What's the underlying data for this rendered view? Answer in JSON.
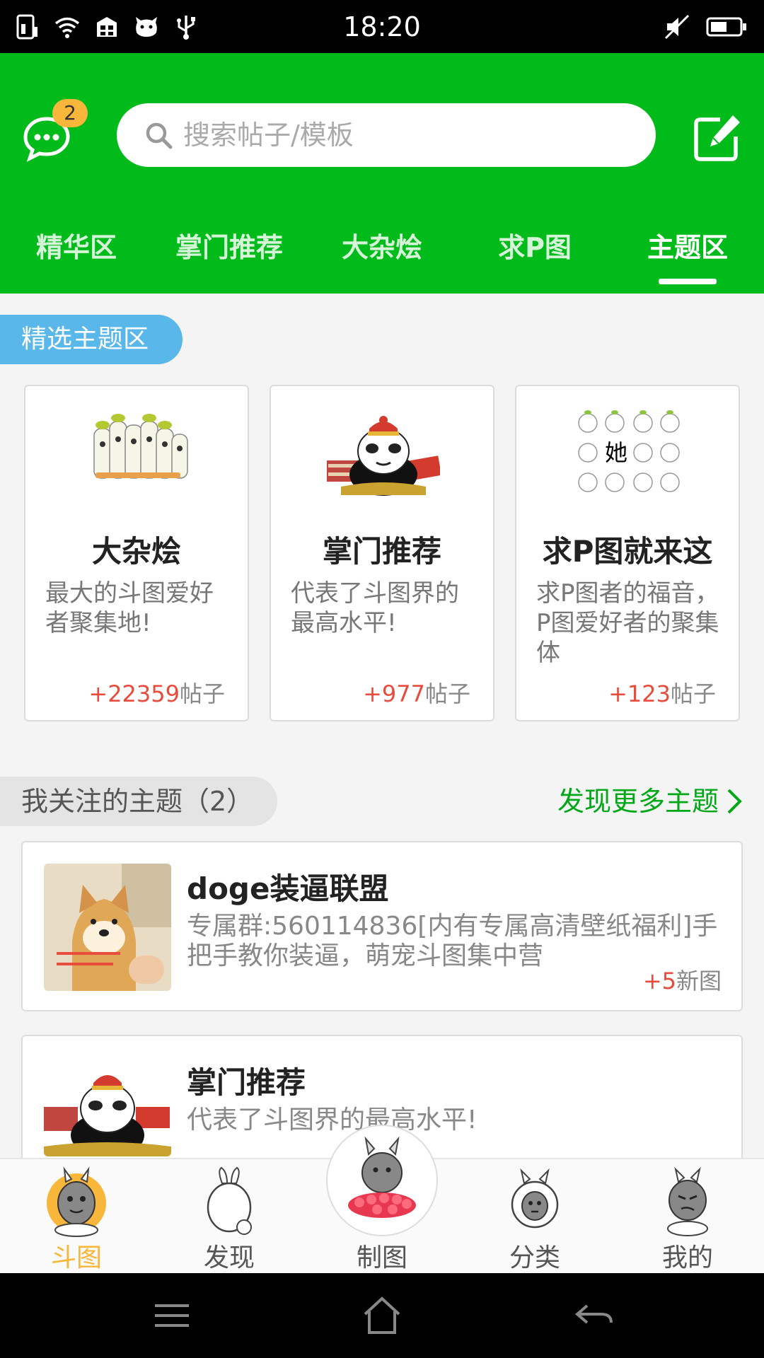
{
  "status_bar": {
    "time": "18:20"
  },
  "header": {
    "badge_count": "2",
    "search_placeholder": "搜索帖子/模板",
    "tabs": [
      {
        "label": "精华区",
        "active": false
      },
      {
        "label": "掌门推荐",
        "active": false
      },
      {
        "label": "大杂烩",
        "active": false
      },
      {
        "label": "求P图",
        "active": false
      },
      {
        "label": "主题区",
        "active": true
      }
    ]
  },
  "featured": {
    "label": "精选主题区",
    "cards": [
      {
        "title": "大杂烩",
        "desc": "最大的斗图爱好者聚集地!",
        "count": "+22359",
        "unit": "帖子"
      },
      {
        "title": "掌门推荐",
        "desc": "代表了斗图界的最高水平!",
        "count": "+977",
        "unit": "帖子"
      },
      {
        "title": "求P图就来这",
        "desc": "求P图者的福音，P图爱好者的聚集体",
        "count": "+123",
        "unit": "帖子",
        "image_text": "她"
      }
    ]
  },
  "followed": {
    "label": "我关注的主题（2）",
    "discover_more": "发现更多主题",
    "topics": [
      {
        "title": "doge装逼联盟",
        "desc": "专属群:560114836[内有专属高清壁纸福利]手把手教你装逼，萌宠斗图集中营",
        "count": "+5",
        "unit": "新图"
      },
      {
        "title": "掌门推荐",
        "desc": "代表了斗图界的最高水平!"
      }
    ]
  },
  "bottom_nav": [
    {
      "label": "斗图",
      "active": true
    },
    {
      "label": "发现",
      "active": false
    },
    {
      "label": "制图",
      "active": false
    },
    {
      "label": "分类",
      "active": false
    },
    {
      "label": "我的",
      "active": false
    }
  ],
  "colors": {
    "brand_green": "#00bb19",
    "accent_orange": "#f8b63a",
    "count_red": "#e84c3d",
    "label_blue": "#5ab7ea"
  }
}
